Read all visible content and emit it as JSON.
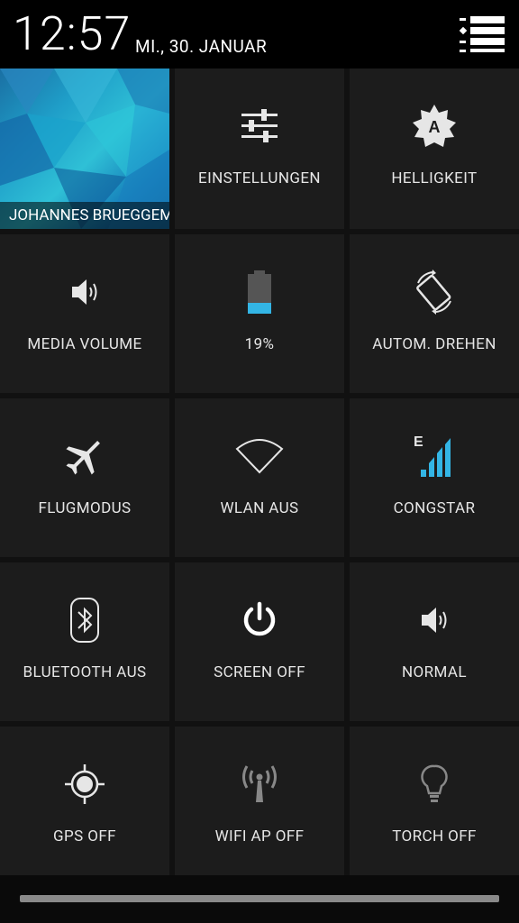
{
  "header": {
    "time": "12:57",
    "date": "MI., 30. JANUAR"
  },
  "user": {
    "name": "JOHANNES BRUEGGEMANN"
  },
  "tiles": {
    "settings": "EINSTELLUNGEN",
    "brightness": "HELLIGKEIT",
    "media_volume": "MEDIA VOLUME",
    "battery": "19%",
    "auto_rotate": "AUTOM. DREHEN",
    "airplane": "FLUGMODUS",
    "wifi": "WLAN AUS",
    "mobile": "CONGSTAR",
    "bluetooth": "BLUETOOTH AUS",
    "screen": "SCREEN OFF",
    "ringer": "NORMAL",
    "gps": "GPS OFF",
    "wifi_ap": "WIFI AP OFF",
    "torch": "TORCH OFF"
  },
  "icons": {
    "mobile_network_type": "E"
  },
  "colors": {
    "accent": "#33b5e5",
    "tile_bg": "#1c1c1c",
    "text": "#e6e6e6"
  }
}
